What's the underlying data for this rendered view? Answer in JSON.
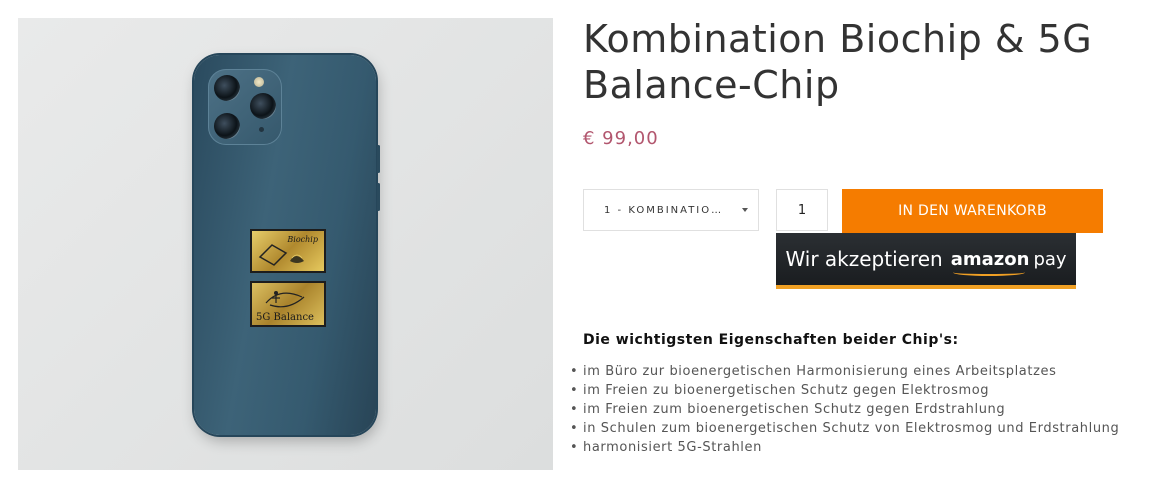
{
  "product": {
    "title": "Kombination Biochip & 5G Balance-Chip",
    "price": "€ 99,00",
    "image_chip_labels": {
      "biochip": "Biochip",
      "balance": "5G Balance"
    }
  },
  "purchase": {
    "variant_selected": "1 - KOMBINATIO…",
    "quantity": "1",
    "add_to_cart_label": "IN DEN WARENKORB"
  },
  "amazon_pay": {
    "lead_text": "Wir akzeptieren",
    "brand": "amazon",
    "suffix": "pay",
    "accent_color": "#f0a024"
  },
  "features": {
    "heading": "Die wichtigsten Eigenschaften beider Chip's:",
    "items": [
      "im Büro zur bioenergetischen Harmonisierung eines Arbeitsplatzes",
      "im Freien zu bioenergetischen Schutz gegen Elektrosmog",
      "im Freien zum bioenergetischen Schutz gegen Erdstrahlung",
      "in Schulen zum bioenergetischen Schutz von Elektrosmog und Erdstrahlung",
      "harmonisiert 5G-Strahlen"
    ]
  },
  "colors": {
    "price": "#b2566e",
    "cart_button": "#f57c00",
    "amazon_bg": "#1f2326"
  }
}
